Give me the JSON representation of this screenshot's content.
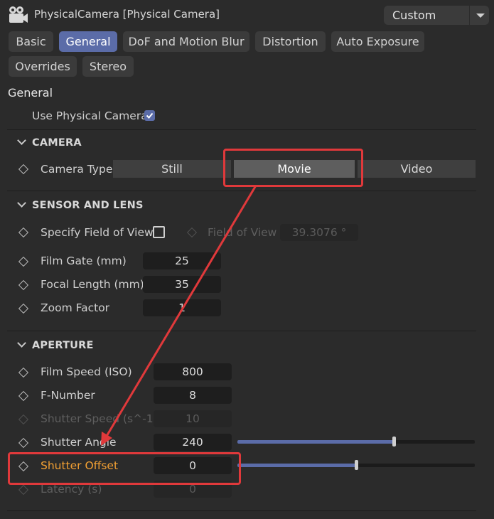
{
  "header": {
    "title": "PhysicalCamera [Physical Camera]",
    "preset": "Custom",
    "icon": "video-camera-icon"
  },
  "tabs": [
    {
      "label": "Basic",
      "active": false
    },
    {
      "label": "General",
      "active": true
    },
    {
      "label": "DoF and Motion Blur",
      "active": false
    },
    {
      "label": "Distortion",
      "active": false
    },
    {
      "label": "Auto Exposure",
      "active": false
    },
    {
      "label": "Overrides",
      "active": false
    },
    {
      "label": "Stereo",
      "active": false
    }
  ],
  "general": {
    "title": "General",
    "use_physical_camera": {
      "label": "Use Physical Camera",
      "checked": true
    }
  },
  "camera": {
    "title": "CAMERA",
    "camera_type_label": "Camera Type",
    "options": [
      "Still",
      "Movie",
      "Video"
    ],
    "selected": "Movie"
  },
  "sensor": {
    "title": "SENSOR AND LENS",
    "specify_fov_label": "Specify Field of View",
    "specify_fov_checked": false,
    "fov_label": "Field of View",
    "fov_value": "39.3076 °",
    "film_gate_label": "Film Gate (mm)",
    "film_gate_value": "25",
    "focal_length_label": "Focal Length (mm)",
    "focal_length_value": "35",
    "zoom_label": "Zoom Factor",
    "zoom_value": "1"
  },
  "aperture": {
    "title": "APERTURE",
    "film_speed_label": "Film Speed (ISO)",
    "film_speed_value": "800",
    "fnumber_label": "F-Number",
    "fnumber_value": "8",
    "shutter_speed_label": "Shutter Speed (s^-1)",
    "shutter_speed_value": "10",
    "shutter_angle_label": "Shutter Angle",
    "shutter_angle_value": "240",
    "shutter_angle_slider": 0.66,
    "shutter_offset_label": "Shutter Offset",
    "shutter_offset_value": "0",
    "shutter_offset_slider": 0.5,
    "latency_label": "Latency (s)",
    "latency_value": "0"
  },
  "colors": {
    "accent": "#5b6ca8",
    "annotation": "#e0393b",
    "highlight_label": "#f2a033"
  }
}
